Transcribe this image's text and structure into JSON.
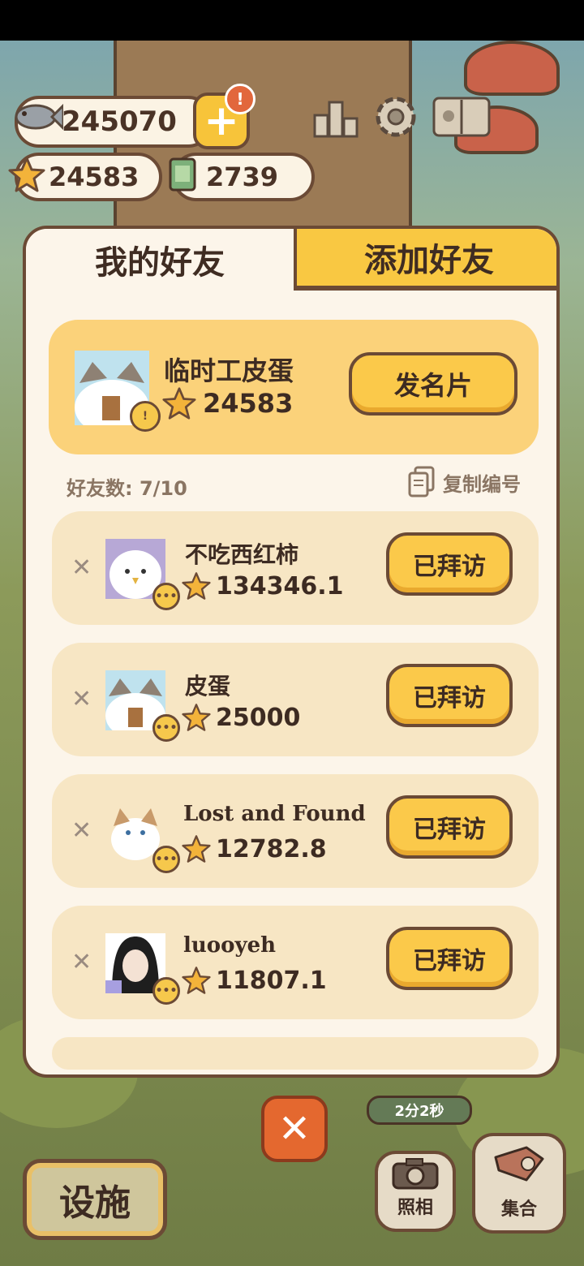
{
  "resources": {
    "fish": "245070",
    "stars": "24583",
    "tickets": "2739",
    "notify": "!"
  },
  "tabs": {
    "my_friends": "我的好友",
    "add_friends": "添加好友"
  },
  "me": {
    "name": "临时工皮蛋",
    "score": "24583",
    "card_button": "发名片"
  },
  "friends_count_label": "好友数: 7/10",
  "copy_id_label": "复制编号",
  "friends": [
    {
      "name": "不吃西红柿",
      "score": "134346.1",
      "button": "已拜访"
    },
    {
      "name": "皮蛋",
      "score": "25000",
      "button": "已拜访"
    },
    {
      "name": "Lost and Found",
      "score": "12782.8",
      "button": "已拜访"
    },
    {
      "name": "luooyeh",
      "score": "11807.1",
      "button": "已拜访"
    }
  ],
  "close_label": "✕",
  "timer": "2分2秒",
  "bottom": {
    "facility": "设施",
    "photo": "照相",
    "gather": "集合"
  },
  "colors": {
    "accent_yellow": "#fbc94a",
    "border_brown": "#6b4a35",
    "panel_cream": "#fcf5ea",
    "close_orange": "#e4682f"
  }
}
